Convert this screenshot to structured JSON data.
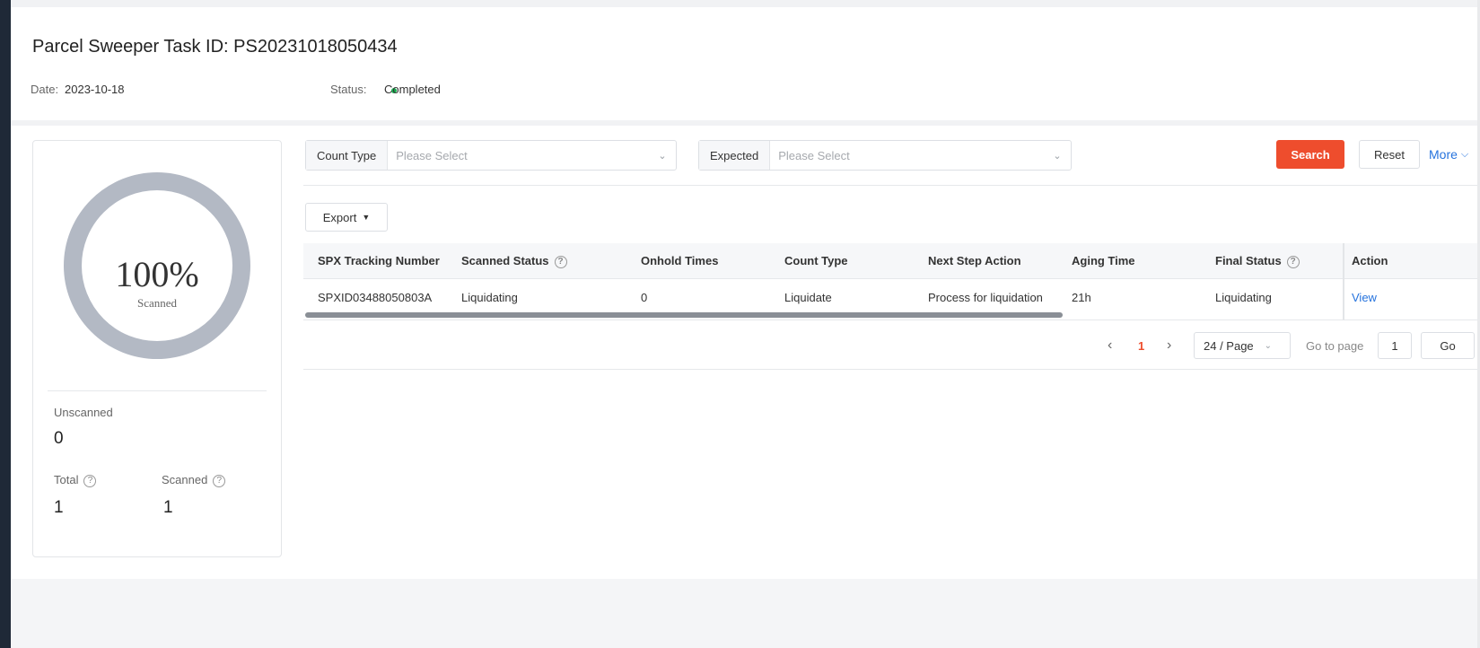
{
  "header": {
    "title": "Parcel Sweeper Task ID: PS20231018050434",
    "date_label": "Date:",
    "date_value": "2023-10-18",
    "status_label": "Status:",
    "status_value": "Completed",
    "status_color": "#16b04f"
  },
  "stats": {
    "percent": "100%",
    "percent_caption": "Scanned",
    "unscanned_label": "Unscanned",
    "unscanned_value": "0",
    "total_label": "Total",
    "total_value": "1",
    "scanned_label": "Scanned",
    "scanned_value": "1"
  },
  "filters": {
    "count_type_label": "Count Type",
    "count_type_placeholder": "Please Select",
    "expected_label": "Expected",
    "expected_placeholder": "Please Select"
  },
  "buttons": {
    "search": "Search",
    "reset": "Reset",
    "more": "More",
    "export": "Export"
  },
  "table": {
    "columns": [
      "SPX Tracking Number",
      "Scanned Status",
      "Onhold Times",
      "Count Type",
      "Next Step Action",
      "Aging Time",
      "Final Status",
      "Action"
    ],
    "rows": [
      [
        "SPXID03488050803A",
        "Liquidating",
        "0",
        "Liquidate",
        "Process for liquidation",
        "21h",
        "Liquidating",
        "View"
      ]
    ]
  },
  "pagination": {
    "current_page": "1",
    "page_size": "24 / Page",
    "goto_label": "Go to page",
    "goto_value": "1",
    "go_button": "Go"
  },
  "colors": {
    "accent": "#ee4d2d",
    "link": "#2673dd",
    "donut": "#b3b9c4"
  }
}
